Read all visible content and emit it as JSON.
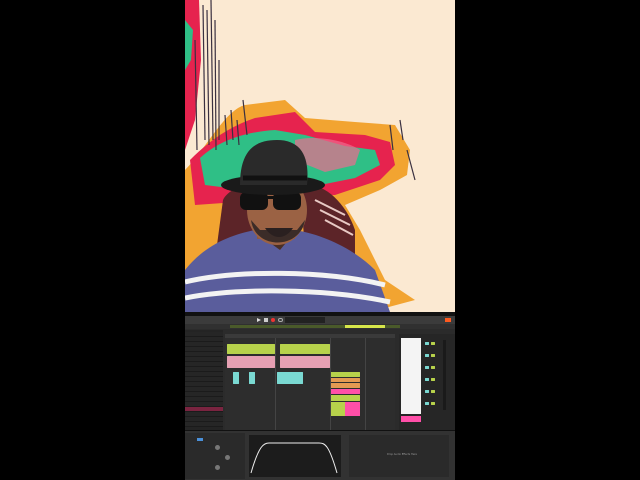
{
  "colors": {
    "background": "#fbe9d2",
    "paint_red": "#e6234e",
    "paint_green": "#2fbf86",
    "paint_orange": "#f2a431",
    "daw_bg": "#2b2b2b",
    "clip_green": "#b7d24b",
    "clip_pink": "#e6a0b3",
    "clip_cyan": "#7ad9d2",
    "clip_orange": "#e39a52",
    "clip_magenta": "#ff4fa8",
    "accent_orange": "#ff5a1f",
    "transport_pink": "#ff4f82"
  },
  "icons": {
    "play": "play-icon",
    "record": "record-icon",
    "stop": "stop-icon",
    "loop": "loop-icon"
  },
  "daw": {
    "panel_placeholder": "Drop Audio Effects Here"
  }
}
